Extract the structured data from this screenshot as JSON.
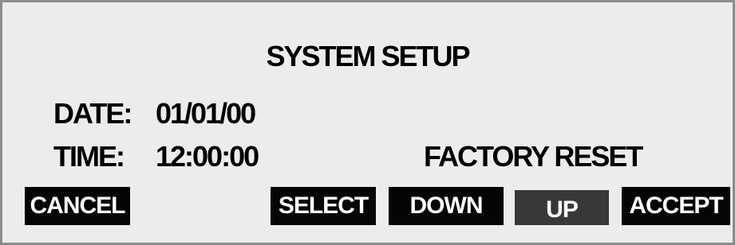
{
  "screen": {
    "title": "SYSTEM SETUP"
  },
  "fields": {
    "date_label": "DATE:",
    "date_value": "01/01/00",
    "time_label": "TIME:",
    "time_value": "12:00:00"
  },
  "options": {
    "factory_reset": "FACTORY RESET"
  },
  "buttons": {
    "cancel": "CANCEL",
    "select": "SELECT",
    "down": "DOWN",
    "up": "UP",
    "accept": "ACCEPT"
  },
  "colors": {
    "panel_background": "#ececec",
    "panel_border": "#8c8c8c",
    "button_background": "#050505",
    "button_up_background": "#383838",
    "text": "#000000",
    "button_text": "#ffffff"
  }
}
